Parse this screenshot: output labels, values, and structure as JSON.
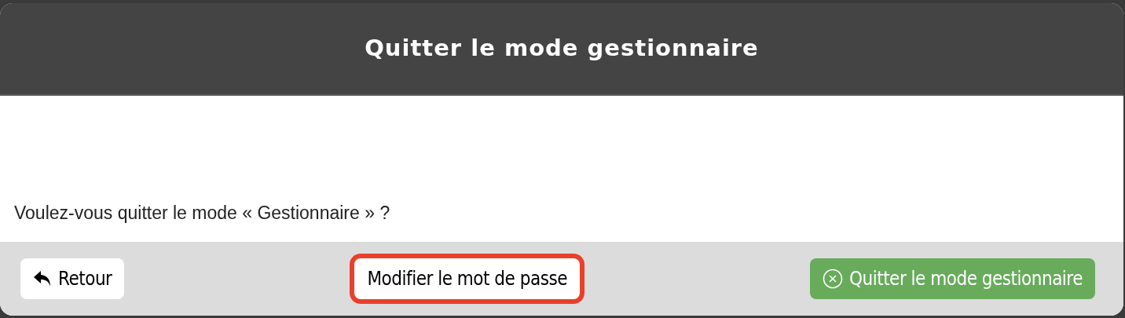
{
  "dialog": {
    "title": "Quitter le mode gestionnaire",
    "message": "Voulez-vous quitter le mode « Gestionnaire » ?",
    "buttons": [
      {
        "kind": "back",
        "label": "Retour",
        "highlighted": false
      },
      {
        "kind": "plain",
        "label": "Modifier le mot de passe",
        "highlighted": true
      },
      {
        "kind": "confirm",
        "label": "Quitter le mode gestionnaire",
        "highlighted": false
      }
    ]
  }
}
